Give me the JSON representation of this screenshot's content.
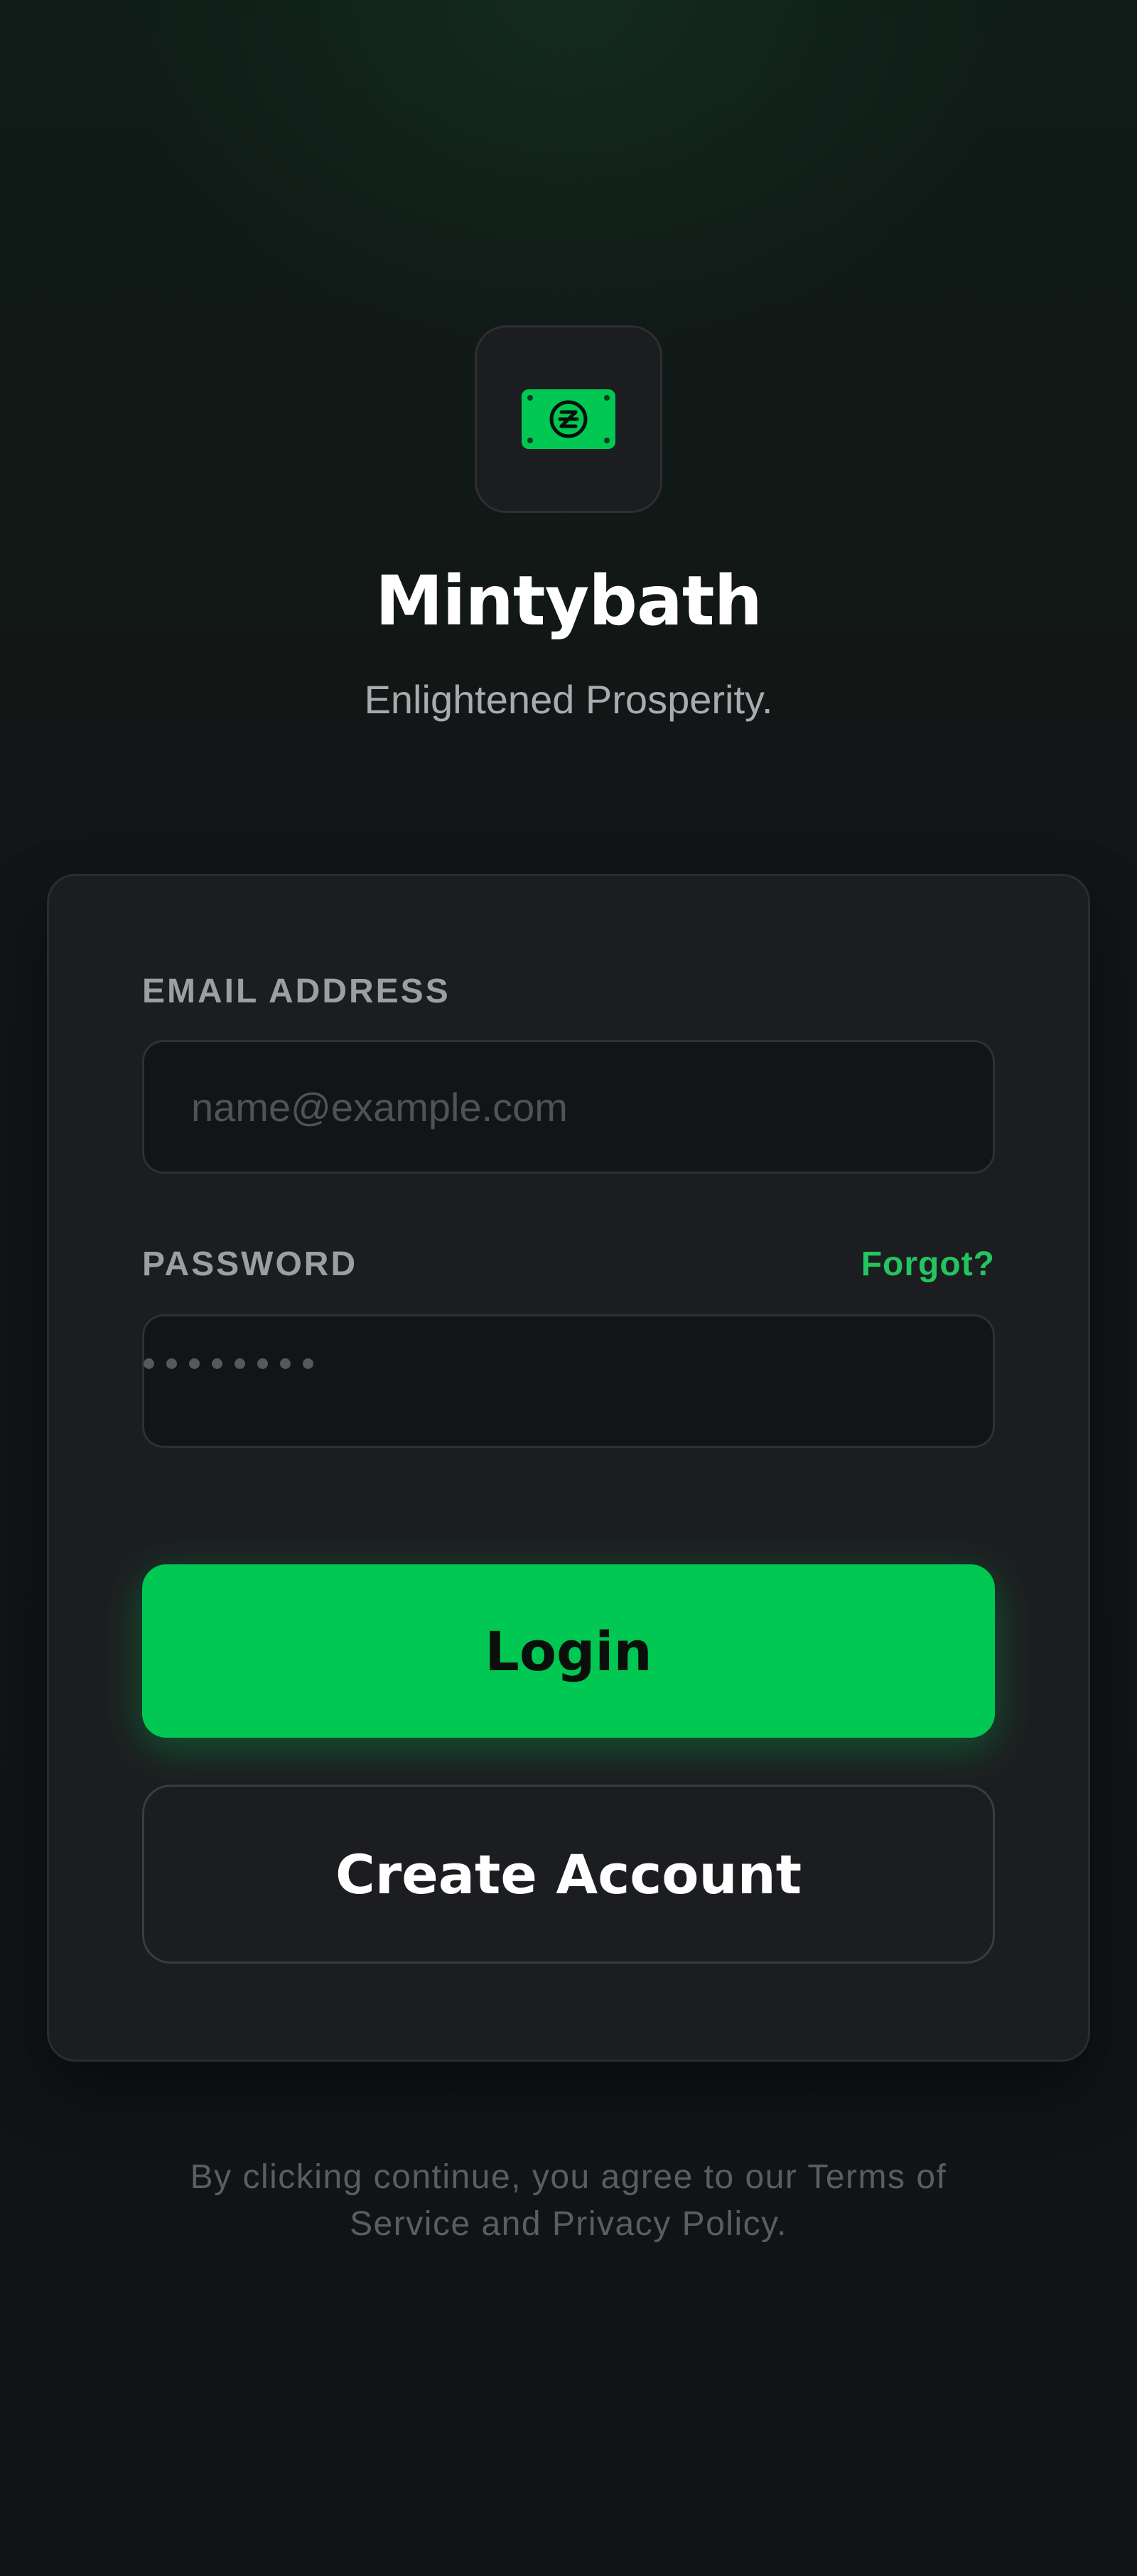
{
  "brand": {
    "logo_icon": "banknote-icon",
    "name": "Mintybath",
    "tagline": "Enlightened Prosperity."
  },
  "form": {
    "email": {
      "label": "EMAIL ADDRESS",
      "placeholder": "name@example.com",
      "value": ""
    },
    "password": {
      "label": "PASSWORD",
      "value_masked": "••••••••",
      "forgot_label": "Forgot?"
    },
    "login_label": "Login",
    "create_account_label": "Create Account"
  },
  "footer": {
    "legal_text": "By clicking continue, you agree to our Terms of Service and Privacy Policy."
  },
  "colors": {
    "accent": "#00c853",
    "link": "#22c55e",
    "card": "#1c1d20",
    "background": "#111317"
  }
}
